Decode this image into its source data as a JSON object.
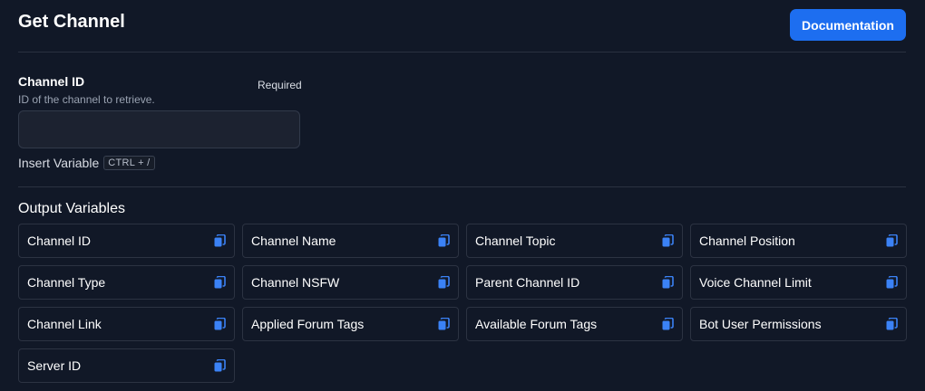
{
  "header": {
    "title": "Get Channel",
    "documentation_label": "Documentation"
  },
  "field": {
    "label": "Channel ID",
    "description": "ID of the channel to retrieve.",
    "required_label": "Required",
    "value": "",
    "placeholder": "",
    "insert_variable_label": "Insert Variable",
    "shortcut": "CTRL + /"
  },
  "output": {
    "title": "Output Variables",
    "variables": [
      "Channel ID",
      "Channel Name",
      "Channel Topic",
      "Channel Position",
      "Channel Type",
      "Channel NSFW",
      "Parent Channel ID",
      "Voice Channel Limit",
      "Channel Link",
      "Applied Forum Tags",
      "Available Forum Tags",
      "Bot User Permissions",
      "Server ID"
    ]
  },
  "colors": {
    "background": "#111827",
    "accent": "#1d6ef0",
    "copy_icon": "#3b82f6",
    "border": "#2c3342"
  },
  "icons": {
    "copy": "copy-icon"
  }
}
